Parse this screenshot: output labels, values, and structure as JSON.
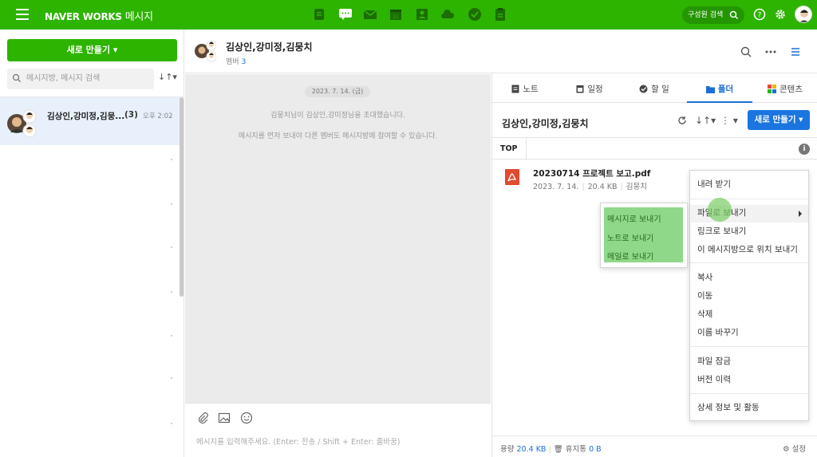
{
  "topbar": {
    "brand": "NAVER WORKS",
    "app_name": "메시지",
    "member_search": "구성원 검색",
    "apps": [
      "board-icon",
      "chat-icon",
      "mail-icon",
      "calendar-icon",
      "contacts-icon",
      "drive-icon",
      "task-icon",
      "approval-icon"
    ],
    "accent": "#2db400"
  },
  "left": {
    "new_button": "새로 만들기",
    "search_placeholder": "메시지방, 메시지 검색",
    "chats": [
      {
        "name": "김상인,강미정,김뭉...",
        "count": "(3)",
        "time": "오후 2:02"
      }
    ]
  },
  "chat": {
    "title": "김상인,강미정,김뭉치",
    "member_label": "멤버",
    "member_count": "3",
    "date": "2023. 7. 14. (금)",
    "system_messages": [
      "김뭉치님이 김상인,강미정님을 초대했습니다.",
      "메시지를 먼저 보내야 다른 멤버도 메시지방에 참여할 수 있습니다."
    ],
    "input_placeholder": "메시지를 입력해주세요. (Enter: 전송 / Shift + Enter: 줄바꿈)"
  },
  "panel": {
    "tabs": [
      {
        "label": "노트"
      },
      {
        "label": "일정"
      },
      {
        "label": "할 일"
      },
      {
        "label": "폴더"
      },
      {
        "label": "콘텐츠"
      }
    ],
    "active_tab": "폴더",
    "folder_title": "김상인,강미정,김뭉치",
    "new_button": "새로 만들기",
    "breadcrumb": "TOP",
    "file": {
      "name": "20230714 프로젝트 보고.pdf",
      "date": "2023. 7. 14.",
      "size": "20.4 KB",
      "owner": "김뭉치"
    },
    "footer": {
      "capacity_label": "용량",
      "capacity_value": "20.4 KB",
      "trash_label": "휴지통",
      "trash_value": "0 B",
      "settings": "설정"
    }
  },
  "context_menu": {
    "items": [
      "내려 받기",
      "파일로 보내기",
      "링크로 보내기",
      "이 메시지방으로 위치 보내기",
      "복사",
      "이동",
      "삭제",
      "이름 바꾸기",
      "파일 잠금",
      "버전 이력",
      "상세 정보 및 활동"
    ],
    "submenu": [
      "메시지로 보내기",
      "노트로 보내기",
      "메일로 보내기"
    ]
  }
}
